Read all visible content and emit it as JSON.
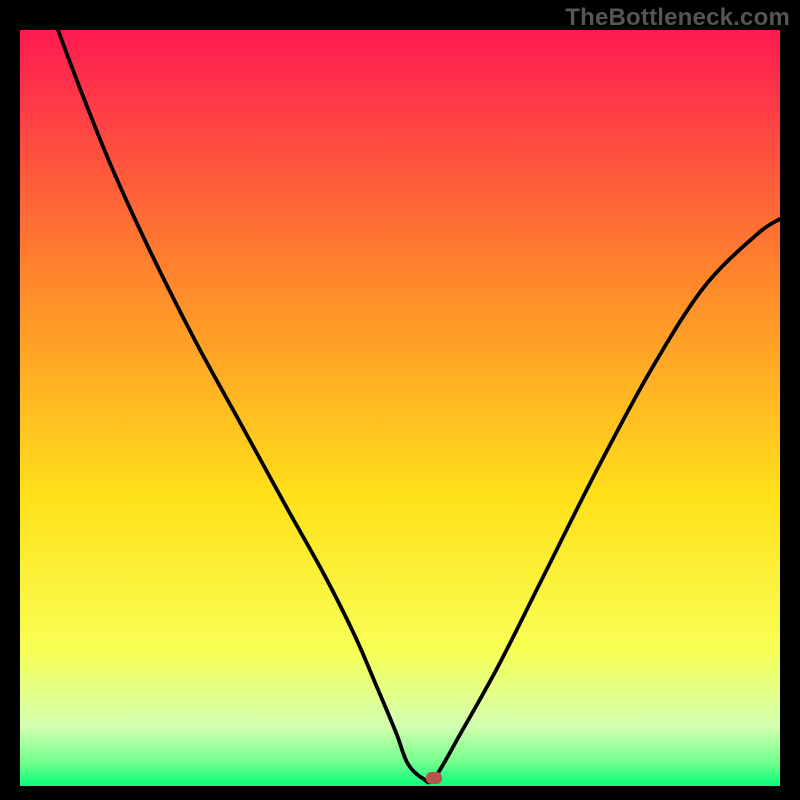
{
  "watermark": {
    "text": "TheBottleneck.com"
  },
  "colors": {
    "top": "#ff1a52",
    "mid_upper": "#ff8a2a",
    "mid": "#ffe11a",
    "mid_lower": "#f7ff54",
    "low_green_pale": "#d4ffb0",
    "low_green": "#6fff8c",
    "bottom": "#05ff7b",
    "curve": "#000000",
    "marker": "#b7544a",
    "frame": "#000000"
  },
  "chart_data": {
    "type": "line",
    "title": "",
    "xlabel": "",
    "ylabel": "",
    "xlim": [
      0,
      100
    ],
    "ylim": [
      0,
      100
    ],
    "grid": false,
    "series": [
      {
        "name": "bottleneck-curve",
        "x": [
          5,
          8,
          12,
          17,
          23,
          29,
          35,
          40,
          44,
          47,
          49.5,
          51,
          53,
          54.5,
          58,
          63,
          69,
          76,
          83,
          90,
          97,
          100
        ],
        "y": [
          100,
          92,
          82,
          71,
          59,
          48,
          37,
          28,
          20,
          13,
          7,
          3,
          1,
          1,
          7,
          16,
          28,
          42,
          55,
          66,
          73,
          75
        ]
      },
      {
        "name": "floor-segment",
        "x": [
          49.5,
          54.5
        ],
        "y": [
          1,
          1
        ]
      }
    ],
    "marker": {
      "x": 54.5,
      "y": 1
    },
    "gradient_stops": [
      {
        "offset": 0,
        "color": "#ff1a52"
      },
      {
        "offset": 0.34,
        "color": "#ff8a2a"
      },
      {
        "offset": 0.62,
        "color": "#ffe11a"
      },
      {
        "offset": 0.82,
        "color": "#f7ff54"
      },
      {
        "offset": 0.92,
        "color": "#d4ffb0"
      },
      {
        "offset": 0.97,
        "color": "#6fff8c"
      },
      {
        "offset": 1.0,
        "color": "#05ff7b"
      }
    ]
  }
}
